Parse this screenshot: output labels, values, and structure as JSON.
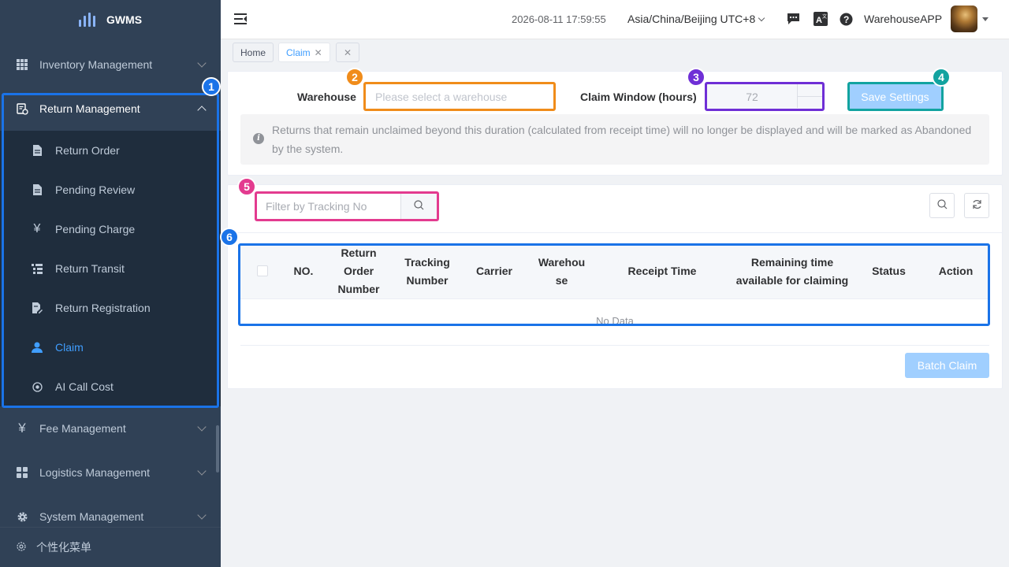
{
  "app": {
    "logo_text": "GWMS"
  },
  "sidebar": {
    "menus": [
      {
        "label": "Inventory Management",
        "icon": "grid-icon"
      },
      {
        "label": "Return Management",
        "icon": "return-icon"
      },
      {
        "label": "Fee Management",
        "icon": "yen-icon"
      },
      {
        "label": "Logistics Management",
        "icon": "apps-icon"
      },
      {
        "label": "System Management",
        "icon": "gear-icon"
      }
    ],
    "submenu": [
      {
        "label": "Return Order",
        "icon": "document-icon"
      },
      {
        "label": "Pending Review",
        "icon": "document-icon"
      },
      {
        "label": "Pending Charge",
        "icon": "yen-icon"
      },
      {
        "label": "Return Transit",
        "icon": "list-icon"
      },
      {
        "label": "Return Registration",
        "icon": "edit-doc-icon"
      },
      {
        "label": "Claim",
        "icon": "user-icon"
      },
      {
        "label": "AI Call Cost",
        "icon": "coin-icon"
      }
    ],
    "bottom_label": "个性化菜单"
  },
  "header": {
    "datetime": "2026-08-11 17:59:55",
    "timezone": "Asia/China/Beijing UTC+8",
    "username": "WarehouseAPP"
  },
  "tabs": [
    {
      "label": "Home"
    },
    {
      "label": "Claim"
    }
  ],
  "settings": {
    "warehouse_label": "Warehouse",
    "warehouse_placeholder": "Please select a warehouse",
    "claim_window_label": "Claim Window (hours)",
    "claim_window_value": "72",
    "save_button": "Save Settings",
    "notice": "Returns that remain unclaimed beyond this duration (calculated from receipt time) will no longer be displayed and will be marked as Abandoned by the system."
  },
  "table": {
    "search_placeholder": "Filter by Tracking No",
    "columns": [
      "NO.",
      "Return Order Number",
      "Tracking Number",
      "Carrier",
      "Warehouse",
      "Receipt Time",
      "Remaining time available for claiming",
      "Status",
      "Action"
    ],
    "empty_text": "No Data",
    "batch_button": "Batch Claim"
  },
  "annotations": [
    "1",
    "2",
    "3",
    "4",
    "5",
    "6"
  ],
  "colors": {
    "sidebar_bg": "#304156",
    "submenu_bg": "#1f2d3d",
    "primary": "#409eff",
    "ann_blue": "#1a73e8",
    "ann_orange": "#f08c1a",
    "ann_purple": "#6f2fd6",
    "ann_teal": "#12a3a0",
    "ann_pink": "#e33b8f"
  }
}
